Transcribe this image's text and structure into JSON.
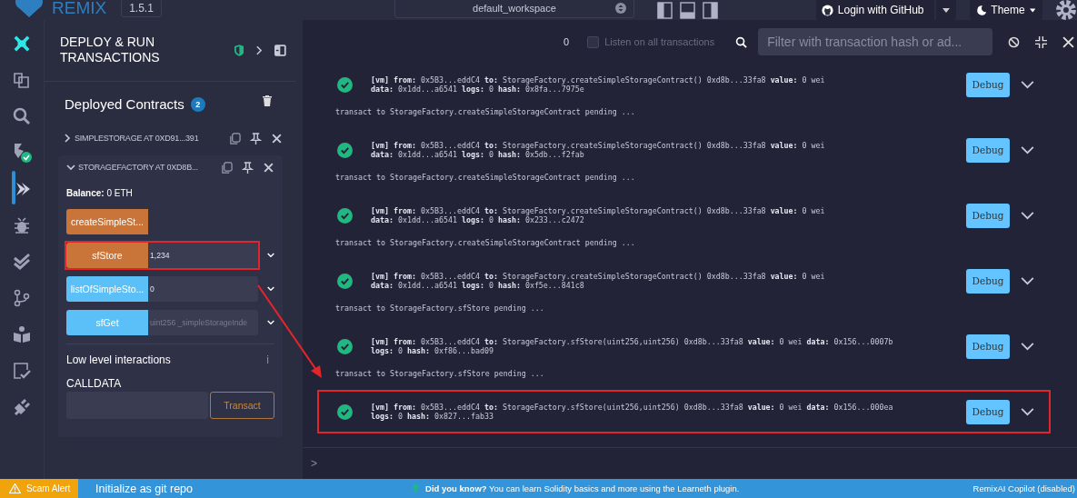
{
  "topbar": {
    "logo": "REMIX",
    "version": "1.5.1",
    "workspace": "default_workspace",
    "login": "Login with GitHub",
    "theme": "Theme"
  },
  "activity_bar": [
    {
      "kind": "ai",
      "selected": false
    },
    {
      "kind": "files",
      "selected": false
    },
    {
      "kind": "search",
      "selected": false
    },
    {
      "kind": "compiler",
      "selected": false,
      "badge": true
    },
    {
      "kind": "deploy",
      "selected": true
    },
    {
      "kind": "debugger",
      "selected": false
    },
    {
      "kind": "tests",
      "selected": false
    },
    {
      "kind": "git",
      "selected": false
    },
    {
      "kind": "learn",
      "selected": false
    },
    {
      "kind": "verify",
      "selected": false
    },
    {
      "kind": "plugin",
      "selected": false
    }
  ],
  "panel": {
    "title": "DEPLOY & RUN TRANSACTIONS",
    "deployed_title": "Deployed Contracts",
    "deployed_count": "2",
    "contracts": [
      {
        "name": "SIMPLESTORAGE AT 0XD91...391",
        "expanded": false
      },
      {
        "name": "STORAGEFACTORY AT 0XD8B...",
        "expanded": true
      }
    ],
    "balance": "**Balance:** 0 ETH",
    "functions": [
      {
        "label": "createSimpleSt...",
        "kind": "transact",
        "highlighted": false
      },
      {
        "label": "sfStore",
        "kind": "transact",
        "value": "1,234",
        "highlighted": true
      },
      {
        "label": "listOfSimpleSto...",
        "kind": "call",
        "value": "0",
        "highlighted": false
      },
      {
        "label": "sfGet",
        "kind": "call",
        "placeholder": "uint256 _simpleStorageInde",
        "highlighted": false
      }
    ],
    "low_level": "Low level interactions",
    "info": "i",
    "calldata_label": "CALLDATA",
    "transact_button": "Transact"
  },
  "terminal": {
    "count": "0",
    "listen_label": "Listen on all transactions",
    "listen_checked": false,
    "filter_placeholder": "Filter with transaction hash or ad...",
    "log": [
      {
        "kind": "tx",
        "highlighted": false,
        "debug": "Debug",
        "lines": [
          "**[vm]** **from:** 0x5B3...eddC4 **to:** StorageFactory.createSimpleStorageContract() 0xd8b...33fa8 **value:** 0 wei",
          "**data:** 0x1dd...a6541 **logs:** 0 **hash:** 0x8fa...7975e"
        ]
      },
      {
        "kind": "pending",
        "text": "transact to StorageFactory.createSimpleStorageContract pending ..."
      },
      {
        "kind": "tx",
        "highlighted": false,
        "debug": "Debug",
        "lines": [
          "**[vm]** **from:** 0x5B3...eddC4 **to:** StorageFactory.createSimpleStorageContract() 0xd8b...33fa8 **value:** 0 wei",
          "**data:** 0x1dd...a6541 **logs:** 0 **hash:** 0x5db...f2fab"
        ]
      },
      {
        "kind": "pending",
        "text": "transact to StorageFactory.createSimpleStorageContract pending ..."
      },
      {
        "kind": "tx",
        "highlighted": false,
        "debug": "Debug",
        "lines": [
          "**[vm]** **from:** 0x5B3...eddC4 **to:** StorageFactory.createSimpleStorageContract() 0xd8b...33fa8 **value:** 0 wei",
          "**data:** 0x1dd...a6541 **logs:** 0 **hash:** 0x233...c2472"
        ]
      },
      {
        "kind": "pending",
        "text": "transact to StorageFactory.createSimpleStorageContract pending ..."
      },
      {
        "kind": "tx",
        "highlighted": false,
        "debug": "Debug",
        "lines": [
          "**[vm]** **from:** 0x5B3...eddC4 **to:** StorageFactory.createSimpleStorageContract() 0xd8b...33fa8 **value:** 0 wei",
          "**data:** 0x1dd...a6541 **logs:** 0 **hash:** 0xf5e...841c8"
        ]
      },
      {
        "kind": "pending",
        "text": "transact to StorageFactory.sfStore pending ..."
      },
      {
        "kind": "tx",
        "highlighted": false,
        "debug": "Debug",
        "lines": [
          "**[vm]** **from:** 0x5B3...eddC4 **to:** StorageFactory.sfStore(uint256,uint256) 0xd8b...33fa8 **value:** 0 wei **data:** 0x156...0007b",
          "**logs:** 0 **hash:** 0xf86...bad09"
        ]
      },
      {
        "kind": "pending",
        "text": "transact to StorageFactory.sfStore pending ..."
      },
      {
        "kind": "tx",
        "highlighted": true,
        "debug": "Debug",
        "lines": [
          "**[vm]** **from:** 0x5B3...eddC4 **to:** StorageFactory.sfStore(uint256,uint256) 0xd8b...33fa8 **value:** 0 wei **data:** 0x156...000ea",
          "**logs:** 0 **hash:** 0x827...fab33"
        ]
      }
    ],
    "prompt": ">"
  },
  "status_bar": {
    "scam_alert": "Scam Alert",
    "git": "Initialize as git repo",
    "tip": "**Did you know?** You can learn Solidity basics and more using the Learneth plugin.",
    "copilot": "RemixAI Copilot (disabled)"
  }
}
